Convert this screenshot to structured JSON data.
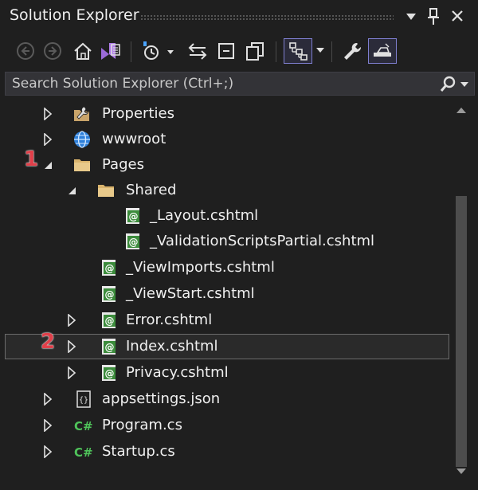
{
  "window": {
    "title": "Solution Explorer"
  },
  "search": {
    "placeholder": "Search Solution Explorer (Ctrl+;)"
  },
  "tree": {
    "properties": "Properties",
    "wwwroot": "wwwroot",
    "pages": "Pages",
    "shared": "Shared",
    "layout": "_Layout.cshtml",
    "validation": "_ValidationScriptsPartial.cshtml",
    "viewimports": "_ViewImports.cshtml",
    "viewstart": "_ViewStart.cshtml",
    "error": "Error.cshtml",
    "index": "Index.cshtml",
    "privacy": "Privacy.cshtml",
    "appsettings": "appsettings.json",
    "program": "Program.cs",
    "startup": "Startup.cs"
  },
  "markers": {
    "one": "1",
    "two": "2"
  },
  "colors": {
    "background": "#1f1f1f",
    "cshtml_icon": "#3c8c3c",
    "marker": "#e0404a",
    "globe": "#4aa3ff",
    "folder": "#d9b36c"
  }
}
